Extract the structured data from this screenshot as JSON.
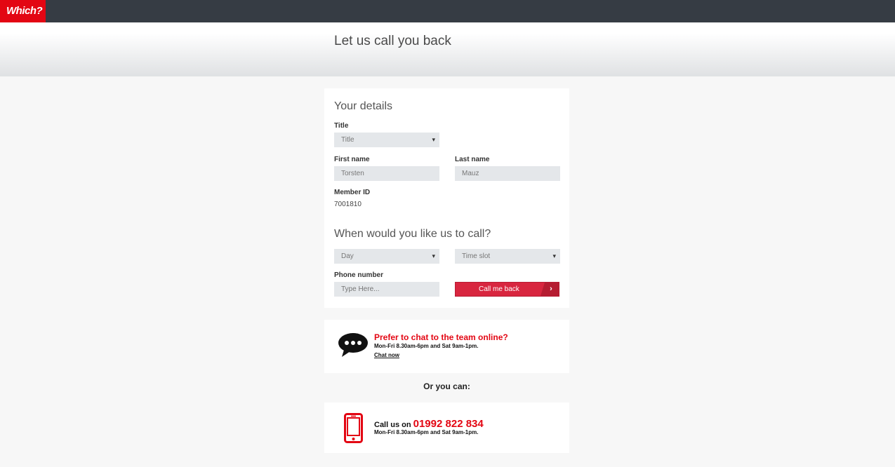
{
  "brand": {
    "logo_text": "Which?",
    "accent_color": "#e30613",
    "topbar_color": "#363c44"
  },
  "page": {
    "title": "Let us call you back"
  },
  "details": {
    "heading": "Your details",
    "title_label": "Title",
    "title_value": "Title",
    "first_name_label": "First name",
    "first_name_value": "Torsten",
    "last_name_label": "Last name",
    "last_name_value": "Mauz",
    "member_id_label": "Member ID",
    "member_id_value": "7001810"
  },
  "schedule": {
    "heading": "When would you like us to call?",
    "day_value": "Day",
    "time_slot_value": "Time slot",
    "phone_label": "Phone number",
    "phone_placeholder": "Type Here...",
    "submit_label": "Call me back",
    "submit_arrow": "›"
  },
  "chat": {
    "icon": "speech-bubble-icon",
    "heading": "Prefer to chat to the team online?",
    "hours": "Mon-Fri 8.30am-6pm and  Sat 9am-1pm.",
    "link": "Chat now"
  },
  "or_text": "Or you can:",
  "call": {
    "icon": "mobile-phone-icon",
    "prefix": "Call us on ",
    "number": "01992 822 834",
    "hours": "Mon-Fri 8.30am-6pm and  Sat 9am-1pm."
  }
}
